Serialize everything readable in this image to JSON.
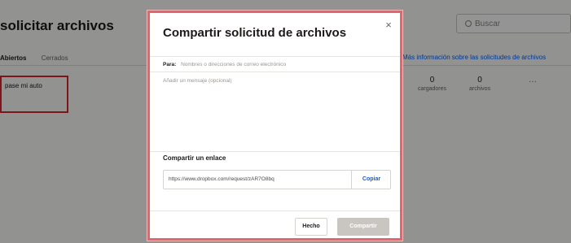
{
  "background": {
    "page_title": "solicitar archivos",
    "search_placeholder": "Buscar",
    "tabs": [
      {
        "label": "Abiertos",
        "active": true
      },
      {
        "label": "Cerrados",
        "active": false
      }
    ],
    "link_text": "Más información sobre las solicitudes de archivos",
    "request_name": "pase mi auto",
    "stats": [
      {
        "value": "0",
        "label": "cargadores"
      },
      {
        "value": "0",
        "label": "archivos"
      }
    ],
    "more": "···"
  },
  "modal": {
    "title": "Compartir solicitud de archivos",
    "close_glyph": "×",
    "to_label": "Para:",
    "to_placeholder": "Nombres o direcciones de correo electrónico",
    "message_placeholder": "Añadir un mensaje (opcional)",
    "share_link_label": "Compartir un enlace",
    "link_url": "https://www.dropbox.com/request/zAR7O8bq",
    "copy_label": "Copiar",
    "done_label": "Hecho",
    "share_label": "Compartir"
  },
  "colors": {
    "highlight": "#d8232a",
    "link": "#0061fe",
    "disabled_button": "#c9c6c2"
  },
  "icons": [
    "search-icon",
    "close-icon",
    "more-icon"
  ]
}
